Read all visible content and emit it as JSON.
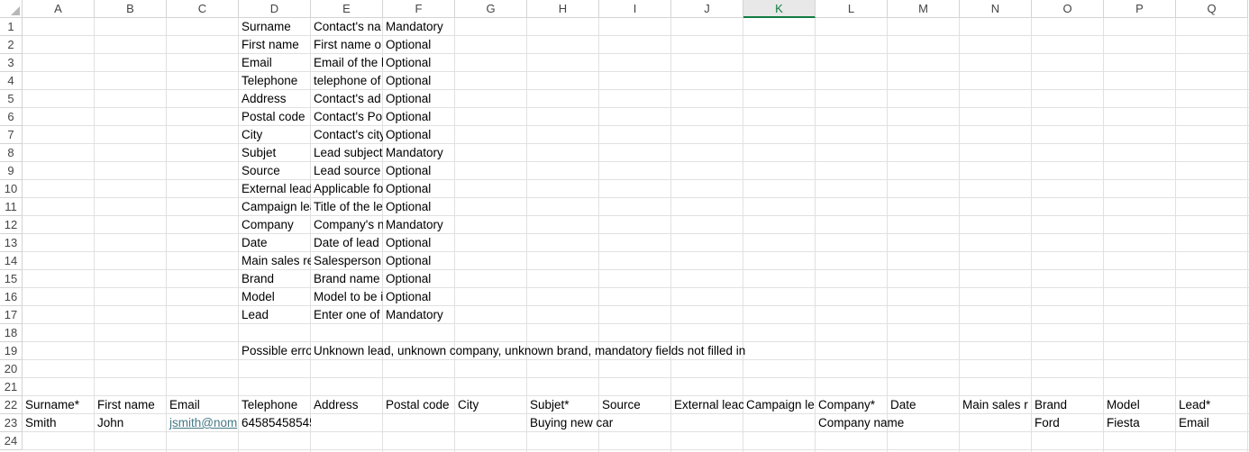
{
  "sheet": {
    "columns": [
      "A",
      "B",
      "C",
      "D",
      "E",
      "F",
      "G",
      "H",
      "I",
      "J",
      "K",
      "L",
      "M",
      "N",
      "O",
      "P",
      "Q"
    ],
    "selected_column": "K",
    "rows": [
      "1",
      "2",
      "3",
      "4",
      "5",
      "6",
      "7",
      "8",
      "9",
      "10",
      "11",
      "12",
      "13",
      "14",
      "15",
      "16",
      "17",
      "18",
      "19",
      "20",
      "21",
      "22",
      "23",
      "24"
    ],
    "field_table": [
      {
        "row": 1,
        "field": "Surname",
        "description": "Contact's na",
        "status": "Mandatory"
      },
      {
        "row": 2,
        "field": "First name",
        "description": "First name o",
        "status": "Optional"
      },
      {
        "row": 3,
        "field": "Email",
        "description": "Email of the l",
        "status": "Optional"
      },
      {
        "row": 4,
        "field": "Telephone",
        "description": "telephone of",
        "status": "Optional"
      },
      {
        "row": 5,
        "field": "Address",
        "description": "Contact's ad",
        "status": "Optional"
      },
      {
        "row": 6,
        "field": "Postal code",
        "description": "Contact's Po",
        "status": "Optional"
      },
      {
        "row": 7,
        "field": "City",
        "description": "Contact's city",
        "status": "Optional"
      },
      {
        "row": 8,
        "field": "Subjet",
        "description": "Lead subject",
        "status": "Mandatory"
      },
      {
        "row": 9,
        "field": "Source",
        "description": "Lead source",
        "status": "Optional"
      },
      {
        "row": 10,
        "field": "External lead",
        "description": "Applicable fo",
        "status": "Optional"
      },
      {
        "row": 11,
        "field": "Campaign lea",
        "description": "Title of the le",
        "status": "Optional"
      },
      {
        "row": 12,
        "field": "Company",
        "description": "Company's n",
        "status": "Mandatory"
      },
      {
        "row": 13,
        "field": "Date",
        "description": "Date of lead",
        "status": "Optional"
      },
      {
        "row": 14,
        "field": "Main sales re",
        "description": "Salesperson",
        "status": "Optional"
      },
      {
        "row": 15,
        "field": "Brand",
        "description": "Brand name",
        "status": "Optional"
      },
      {
        "row": 16,
        "field": "Model",
        "description": "Model to be i",
        "status": "Optional"
      },
      {
        "row": 17,
        "field": "Lead",
        "description": "Enter one of t",
        "status": "Mandatory"
      }
    ],
    "errors_row": {
      "label": "Possible erro",
      "text": "Unknown lead, unknown company, unknown brand, mandatory fields not filled in"
    },
    "header_row": [
      "Surname*",
      "First name",
      "Email",
      "Telephone",
      "Address",
      "Postal code",
      "City",
      "Subjet*",
      "Source",
      "External leac",
      "Campaign le",
      "Company*",
      "Date",
      "Main sales r",
      "Brand",
      "Model",
      "Lead*"
    ],
    "example_row": [
      "Smith",
      "John",
      "jsmith@nom",
      "64585458545",
      "",
      "",
      "",
      "Buying new car",
      "",
      "",
      "",
      "Company name",
      "",
      "",
      "Ford",
      "Fiesta",
      "Email"
    ]
  }
}
